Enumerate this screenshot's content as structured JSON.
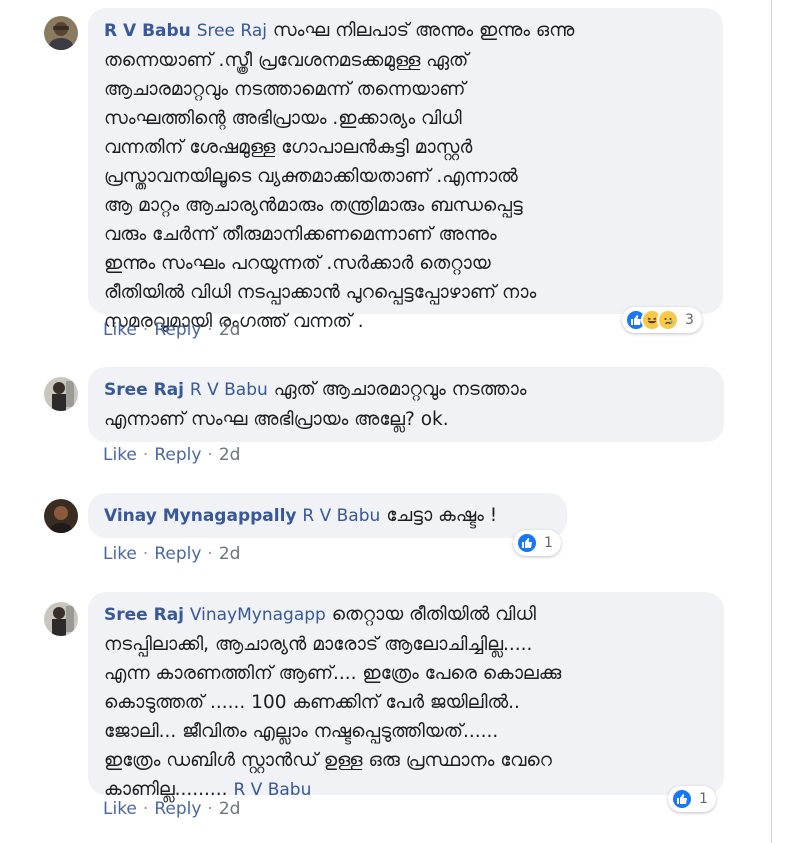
{
  "colors": {
    "author": "#385898",
    "bubble": "#f0f2f5",
    "like_blue": "#1877f2",
    "action_gray": "#6a7681"
  },
  "comments": [
    {
      "author": "R V Babu",
      "mention": "Sree Raj",
      "text": "സംഘ നിലപാട് അന്നും ഇന്നും ഒന്നു\nതന്നെയാണ് .സ്ത്രീ പ്രവേശനമടക്കമുള്ള ഏത്\nആചാരമാറ്റവും നടത്താമെന്ന് തന്നെയാണ്\nസംഘത്തിന്റെ അഭിപ്രായം .ഇക്കാര്യം വിധി\nവന്നതിന് ശേഷമുള്ള ഗോപാലൻകുട്ടി മാസ്റ്റർ\nപ്രസ്താവനയിലൂടെ വ്യക്തമാക്കിയതാണ് .എന്നാൽ\nആ മാറ്റം ആചാര്യൻമാരും തന്ത്രിമാരും ബന്ധപ്പെട്ട\nവരും ചേർന്ന് തീരുമാനിക്കണമെന്നാണ് അന്നും\nഇന്നും സംഘം പറയുന്നത് .സർക്കാർ തെറ്റായ\nരീതിയിൽ വിധി നടപ്പാക്കാൻ പുറപ്പെട്ടപ്പോഴാണ് നാം\nസമരവുമായി രംഗത്ത് വന്നത് .",
      "like": "Like",
      "reply": "Reply",
      "time": "2d",
      "reactions": [
        "like-icon",
        "haha-icon",
        "sad-icon"
      ],
      "reaction_count": "3"
    },
    {
      "author": "Sree Raj",
      "mention": "R V Babu",
      "text": "ഏത് ആചാരമാറ്റവും നടത്താം\nഎന്നാണ് സംഘ അഭിപ്രായം അല്ലേ? ok.",
      "like": "Like",
      "reply": "Reply",
      "time": "2d"
    },
    {
      "author": "Vinay Mynagappally",
      "mention": "R V Babu",
      "text": "ചേട്ടാ കഷ്ടം !",
      "like": "Like",
      "reply": "Reply",
      "time": "2d",
      "reactions": [
        "like-icon"
      ],
      "reaction_count": "1"
    },
    {
      "author": "Sree Raj",
      "mention": "VinayMynagapp",
      "text": "തെറ്റായ രീതിയിൽ വിധി\nനടപ്പിലാക്കി, ആചാര്യൻ മാരോട് ആലോചിച്ചില്ല.....\nഎന്ന കാരണത്തിന് ആണ്.... ഇത്രേം പേരെ കൊലക്കു\nകൊടുത്തത് ...... 100 കണക്കിന് പേർ ജയിലിൽ..\nജോലി... ജീവിതം എല്ലാം നഷ്ടപ്പെടുത്തിയത്......\nഇത്രേം ഡബിൾ സ്റ്റാൻഡ് ഉള്ള ഒരു പ്രസ്ഥാനം വേറെ\nകാണില്ല.........",
      "trailing_mention": "R V Babu",
      "like": "Like",
      "reply": "Reply",
      "time": "2d",
      "reactions": [
        "like-icon"
      ],
      "reaction_count": "1"
    }
  ]
}
